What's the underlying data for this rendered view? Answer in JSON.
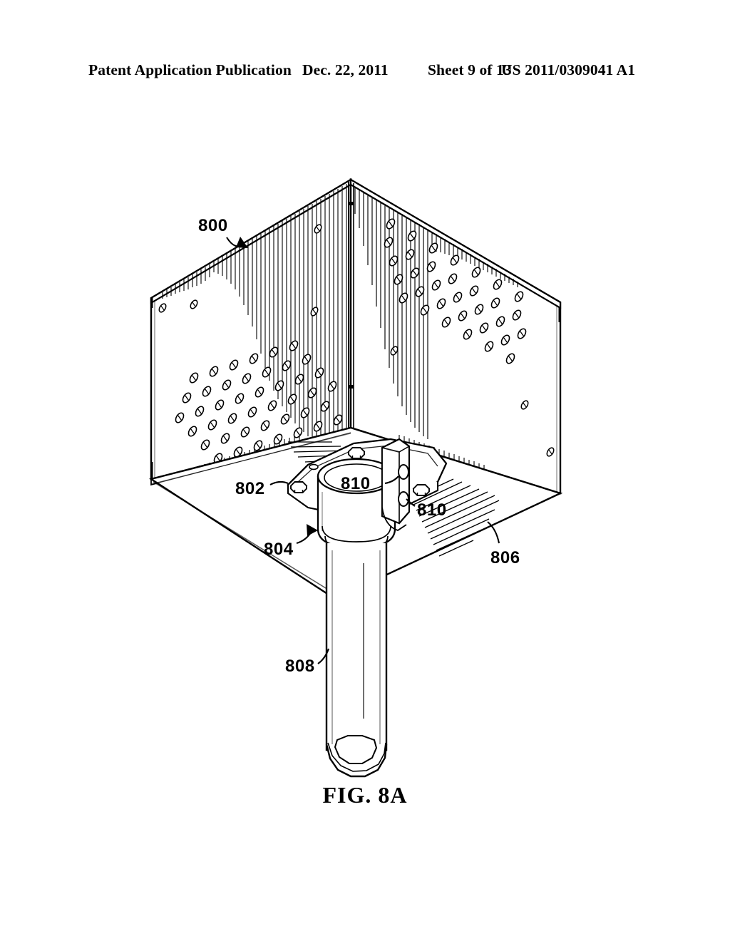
{
  "document": {
    "type": "patent-drawing-sheet",
    "header": {
      "publication_label": "Patent Application Publication",
      "date": "Dec. 22, 2011",
      "sheet": "Sheet 9 of 13",
      "publication_number": "US 2011/0309041 A1"
    },
    "figure": {
      "caption": "FIG. 8A",
      "subject": "Perforated enclosure with flange-mounted support tube"
    }
  },
  "reference_numerals": [
    {
      "id": "800",
      "label": "800",
      "target": "enclosure-assembly",
      "leader": "curved-arrow"
    },
    {
      "id": "802",
      "label": "802",
      "target": "mounting-flange-plate",
      "leader": "curved-line"
    },
    {
      "id": "804",
      "label": "804",
      "target": "collar-sleeve",
      "leader": "curved-arrow"
    },
    {
      "id": "806",
      "label": "806",
      "target": "bottom-panel",
      "leader": "curved-line"
    },
    {
      "id": "808",
      "label": "808",
      "target": "support-tube",
      "leader": "curved-line"
    },
    {
      "id": "810",
      "label": "810",
      "target": "bracket-hole-upper",
      "leader": "curved-line"
    },
    {
      "id": "810",
      "label": "810",
      "target": "bracket-hole-lower",
      "leader": "curved-line"
    }
  ],
  "colors": {
    "ink": "#000000",
    "paper": "#ffffff",
    "hatch": "#111111"
  },
  "drawing_elements": {
    "enclosure": "inverted perforated sheet-metal box shown from below",
    "panels": [
      "left-panel",
      "front-panel",
      "right-panel",
      "bottom-panel"
    ],
    "perforation_pattern": "diagonal grid of small elliptical holes",
    "flange": "rectangular plate with four hex-bolt heads",
    "tube": "vertical cylindrical tube with open faceted bottom end",
    "bracket": "vertical bracket with two round holes"
  }
}
